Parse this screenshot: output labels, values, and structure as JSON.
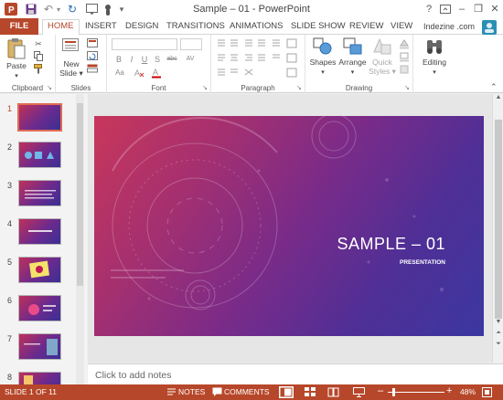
{
  "window": {
    "title": "Sample – 01 - PowerPoint",
    "help_icon": "?",
    "minimize_icon": "–",
    "restore_icon": "❐",
    "close_icon": "✕"
  },
  "quick_access": {
    "undo_icon": "↶",
    "redo_icon": "↻",
    "more_icon": "▾"
  },
  "tabs": {
    "file": "FILE",
    "items": [
      "HOME",
      "INSERT",
      "DESIGN",
      "TRANSITIONS",
      "ANIMATIONS",
      "SLIDE SHOW",
      "REVIEW",
      "VIEW"
    ],
    "account": "Indezine .com",
    "active": "HOME"
  },
  "ribbon": {
    "clipboard": {
      "paste": "Paste",
      "label": "Clipboard"
    },
    "slides": {
      "new_slide_line1": "New",
      "new_slide_line2": "Slide ▾",
      "label": "Slides"
    },
    "font": {
      "label": "Font",
      "bold": "B",
      "italic": "I",
      "underline": "U",
      "strike": "S",
      "shadow": "abc",
      "spacing": "AV",
      "case": "Aa",
      "grow": "A",
      "shrink": "A"
    },
    "paragraph": {
      "label": "Paragraph"
    },
    "drawing": {
      "label": "Drawing",
      "shapes": "Shapes",
      "arrange": "Arrange",
      "quick_styles_line1": "Quick",
      "quick_styles_line2": "Styles ▾"
    },
    "editing": {
      "label": "Editing"
    }
  },
  "thumbnails": [
    "1",
    "2",
    "3",
    "4",
    "5",
    "6",
    "7",
    "8"
  ],
  "slide": {
    "title": "SAMPLE – 01",
    "subtitle": "PRESENTATION"
  },
  "notes_placeholder": "Click to add notes",
  "status": {
    "slide_info": "SLIDE 1 OF 11",
    "notes": "NOTES",
    "comments": "COMMENTS",
    "zoom": "48%",
    "zoom_minus": "–",
    "zoom_plus": "+"
  },
  "colors": {
    "accent": "#b7472a",
    "slide_start": "#c8375b",
    "slide_end": "#3b37a0"
  }
}
